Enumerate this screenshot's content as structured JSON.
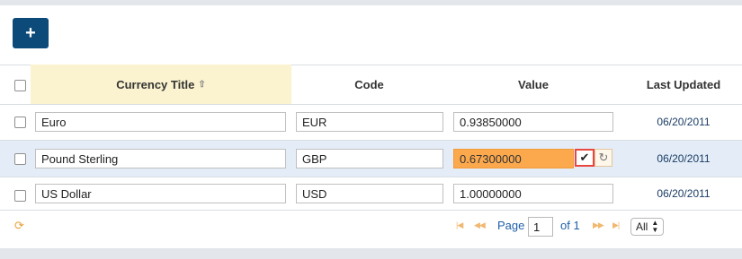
{
  "toolbar": {
    "add_label": "+"
  },
  "grid": {
    "columns": {
      "title": "Currency Title",
      "code": "Code",
      "value": "Value",
      "last_updated": "Last Updated"
    },
    "sort": {
      "column": "Currency Title",
      "direction": "ascending",
      "icon": "sort-up-icon"
    },
    "rows": [
      {
        "title": "Euro",
        "code": "EUR",
        "value": "0.93850000",
        "last_updated": "06/20/2011",
        "editing": false
      },
      {
        "title": "Pound Sterling",
        "code": "GBP",
        "value": "0.67300000",
        "last_updated": "06/20/2011",
        "editing": true
      },
      {
        "title": "US Dollar",
        "code": "USD",
        "value": "1.00000000",
        "last_updated": "06/20/2011",
        "editing": false
      }
    ]
  },
  "pager": {
    "page_label": "Page",
    "page_value": "1",
    "of_label": "of 1",
    "size_option": "All"
  },
  "colors": {
    "add_button": "#0c4a7a",
    "sorted_header": "#fbf3cf",
    "selected_row": "#e4edf7",
    "editing_field": "#fca94d",
    "highlight_border": "#e8473f",
    "link": "#1f5fa8"
  }
}
